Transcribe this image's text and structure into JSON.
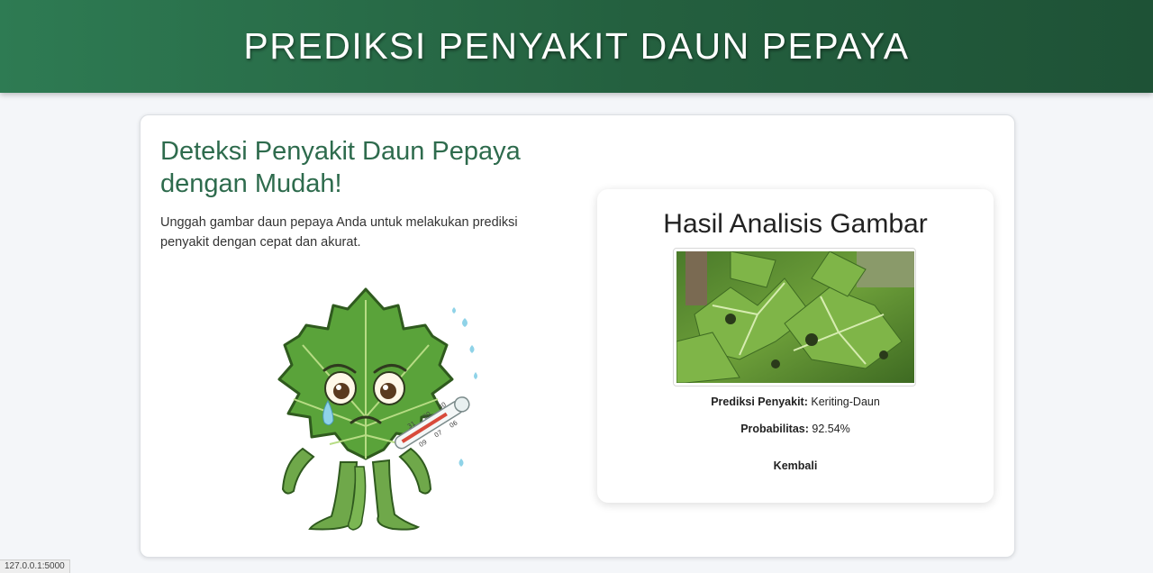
{
  "header": {
    "title": "PREDIKSI PENYAKIT DAUN PEPAYA"
  },
  "intro": {
    "heading": "Deteksi Penyakit Daun Pepaya dengan Mudah!",
    "description": "Unggah gambar daun pepaya Anda untuk melakukan prediksi penyakit dengan cepat dan akurat.",
    "thermometer_marks": [
      "31",
      "30",
      "30",
      "09",
      "07",
      "06"
    ]
  },
  "result": {
    "title": "Hasil Analisis Gambar",
    "prediction_label": "Prediksi Penyakit:",
    "prediction_value": "Keriting-Daun",
    "probability_label": "Probabilitas:",
    "probability_value": "92.54%",
    "back_label": "Kembali"
  },
  "status_bar": {
    "url": "127.0.0.1:5000"
  },
  "colors": {
    "header_start": "#2e7b53",
    "header_end": "#1e5236",
    "heading_green": "#2e6b4d",
    "leaf_green": "#5aa33a"
  }
}
